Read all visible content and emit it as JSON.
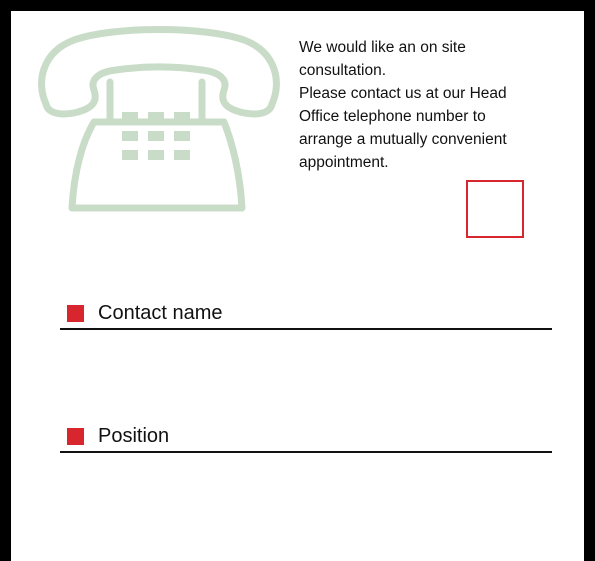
{
  "message": {
    "lines": [
      "We would like an on site",
      "consultation.",
      "Please contact us at our Head",
      "Office telephone number to",
      "arrange a mutually convenient",
      "appointment."
    ]
  },
  "fields": {
    "contact_name": {
      "label": "Contact name",
      "value": ""
    },
    "position": {
      "label": "Position",
      "value": ""
    }
  },
  "checkbox": {
    "checked": false
  },
  "icons": {
    "phone": "telephone-icon",
    "bullet": "square-bullet-icon"
  },
  "colors": {
    "accent": "#d8262e",
    "phone_icon": "#c9dcc8",
    "text": "#111111",
    "frame": "#000000"
  }
}
